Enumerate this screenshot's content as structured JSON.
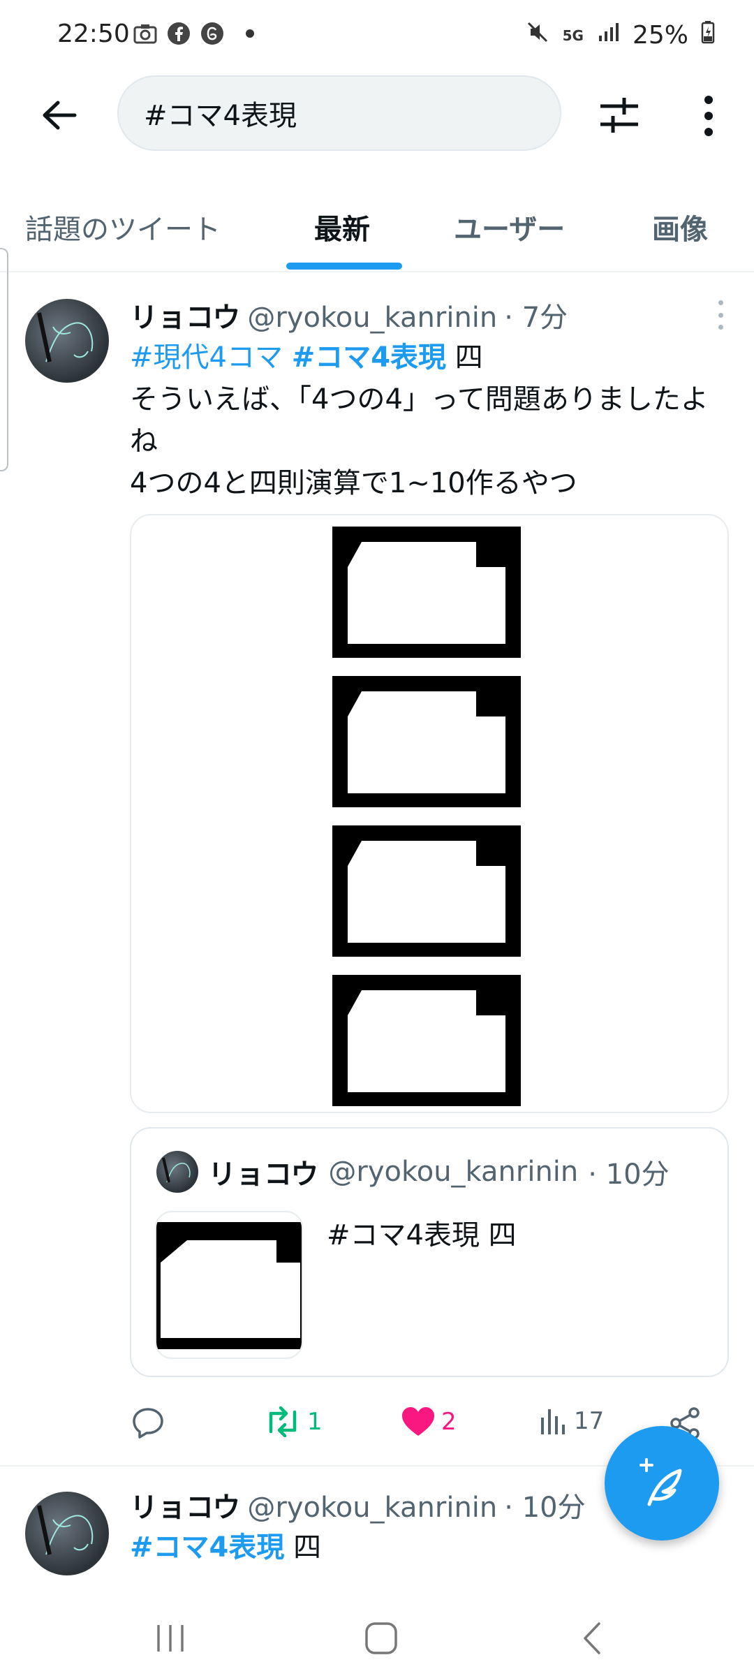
{
  "status_bar": {
    "time": "22:50",
    "network": "5G",
    "battery": "25%",
    "icons": [
      "camera-icon",
      "facebook-icon",
      "threads-icon",
      "dot-icon",
      "mute-icon",
      "signal-icon",
      "battery-icon"
    ]
  },
  "header": {
    "search_value": "#コマ4表現",
    "icons": [
      "back-arrow-icon",
      "filter-icon",
      "more-vertical-icon"
    ]
  },
  "tabs": [
    {
      "label": "話題のツイート",
      "active": false
    },
    {
      "label": "最新",
      "active": true
    },
    {
      "label": "ユーザー",
      "active": false
    },
    {
      "label": "画像",
      "active": false
    }
  ],
  "tweet": {
    "name": "リョコウ",
    "handle": "@ryokou_kanrinin",
    "time": "· 7分",
    "hashtag1": "#現代4コマ",
    "hashtag2": "#コマ4表現",
    "suffix": "四",
    "line1": "そういえば、「4つの4」って問題ありましたよね",
    "line2": "4つの4と四則演算で1~10作るやつ",
    "quote": {
      "name": "リョコウ",
      "handle": "@ryokou_kanrinin",
      "time": "· 10分",
      "text": "#コマ4表現 四"
    },
    "actions": {
      "retweets": "1",
      "likes": "2",
      "views": "17"
    }
  },
  "tweet2": {
    "name": "リョコウ",
    "handle": "@ryokou_kanrinin",
    "time": "· 10分",
    "hashtag": "#コマ4表現",
    "suffix": "四"
  },
  "colors": {
    "accent": "#1d9bf0",
    "retweet": "#00ba7c",
    "like": "#f91880",
    "secondary_text": "#536471"
  }
}
